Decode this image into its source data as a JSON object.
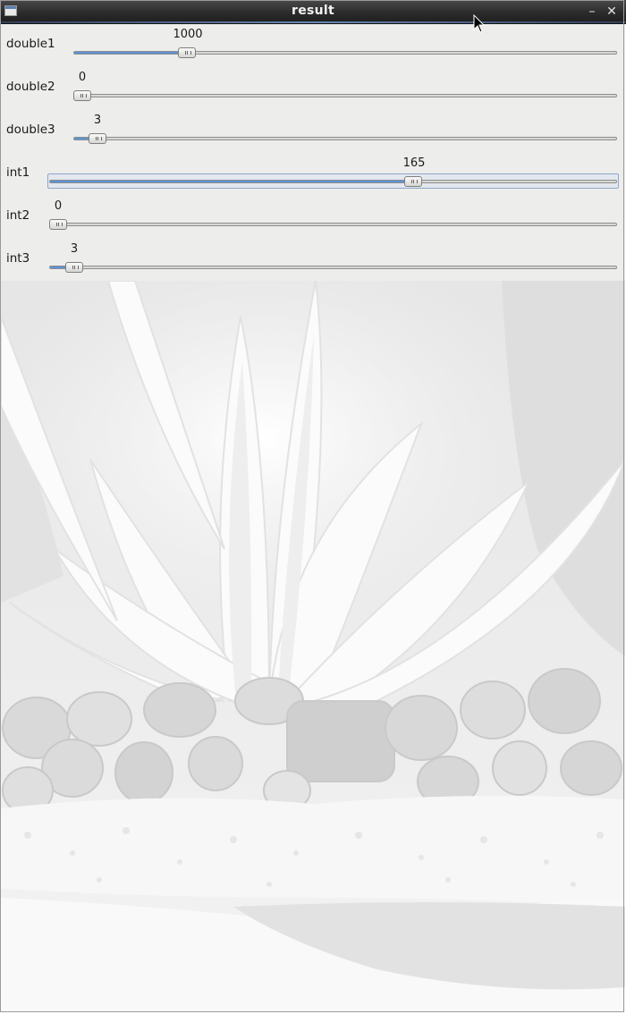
{
  "window": {
    "title": "result",
    "icon": "window-app-icon",
    "controls": [
      "minimize-icon",
      "close-icon"
    ],
    "minimize_glyph": "–",
    "close_glyph": "✕"
  },
  "sliders": [
    {
      "label": "double1",
      "value": "1000",
      "fraction": 0.2
    },
    {
      "label": "double2",
      "value": "0",
      "fraction": 0.0
    },
    {
      "label": "double3",
      "value": "3",
      "fraction": 0.03
    },
    {
      "label": "int1",
      "value": "165",
      "fraction": 0.65,
      "focused": true
    },
    {
      "label": "int2",
      "value": "0",
      "fraction": 0.0
    },
    {
      "label": "int3",
      "value": "3",
      "fraction": 0.04
    }
  ],
  "image": {
    "subject": "aquarium plant over pebbles and gravel, washed-out grayscale"
  },
  "colors": {
    "titlebar": "#2b2b2b",
    "panel_bg": "#ededeb",
    "slider_fill": "#5b92d6",
    "focus_border": "#8fa7c9"
  }
}
